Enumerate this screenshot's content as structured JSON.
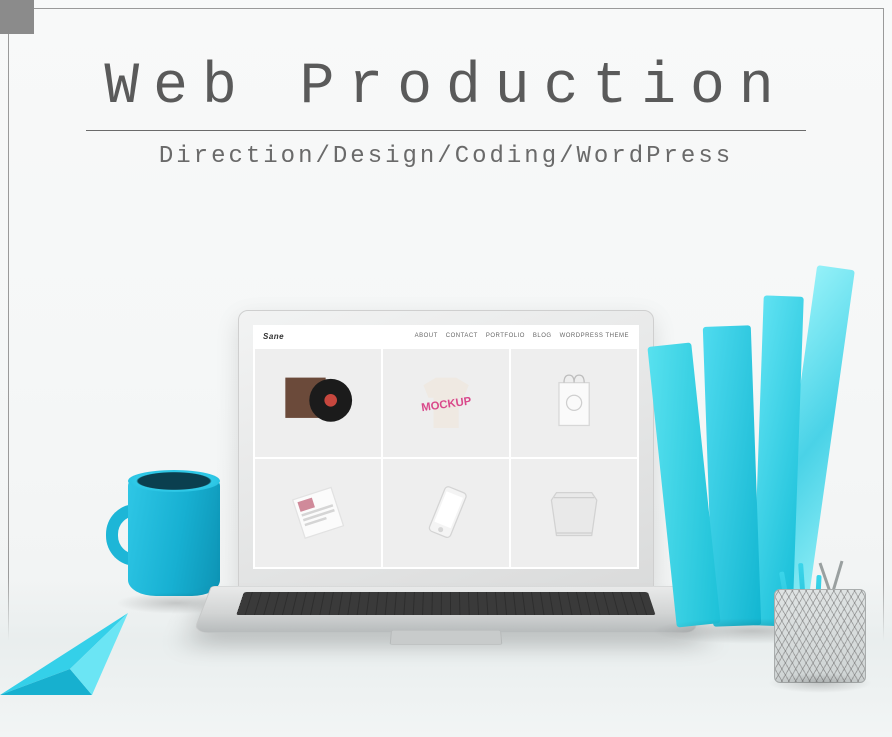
{
  "banner": {
    "title": "Web Production",
    "subtitle": "Direction/Design/Coding/WordPress"
  },
  "laptop_site": {
    "logo": "Sane",
    "nav": [
      "ABOUT",
      "CONTACT",
      "PORTFOLIO",
      "BLOG",
      "WORDPRESS THEME"
    ],
    "tiles": [
      "vinyl-record",
      "tshirt-mockup",
      "shopping-bag",
      "magazine",
      "smartphone",
      "foil-package"
    ]
  }
}
